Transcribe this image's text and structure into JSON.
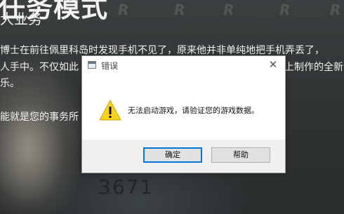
{
  "background": {
    "title_partial": "任务模式",
    "subtitle": "大业务",
    "lines": [
      "博士在前往佩里科岛时发现手机不见了，原来他并非单纯地把手机弄丢了，",
      "人手中。不仅如此",
      "乐。",
      "能就是您的事务所"
    ],
    "right_fragment": "上制作的全新",
    "number": "3671",
    "watermark": "R"
  },
  "dialog": {
    "title": "错误",
    "close_glyph": "✕",
    "message": "无法启动游戏，请验证您的游戏数据。",
    "ok_label": "确定",
    "help_label": "帮助"
  },
  "colors": {
    "warning_fill": "#f7d21d",
    "button_focus_border": "#0078d7"
  }
}
